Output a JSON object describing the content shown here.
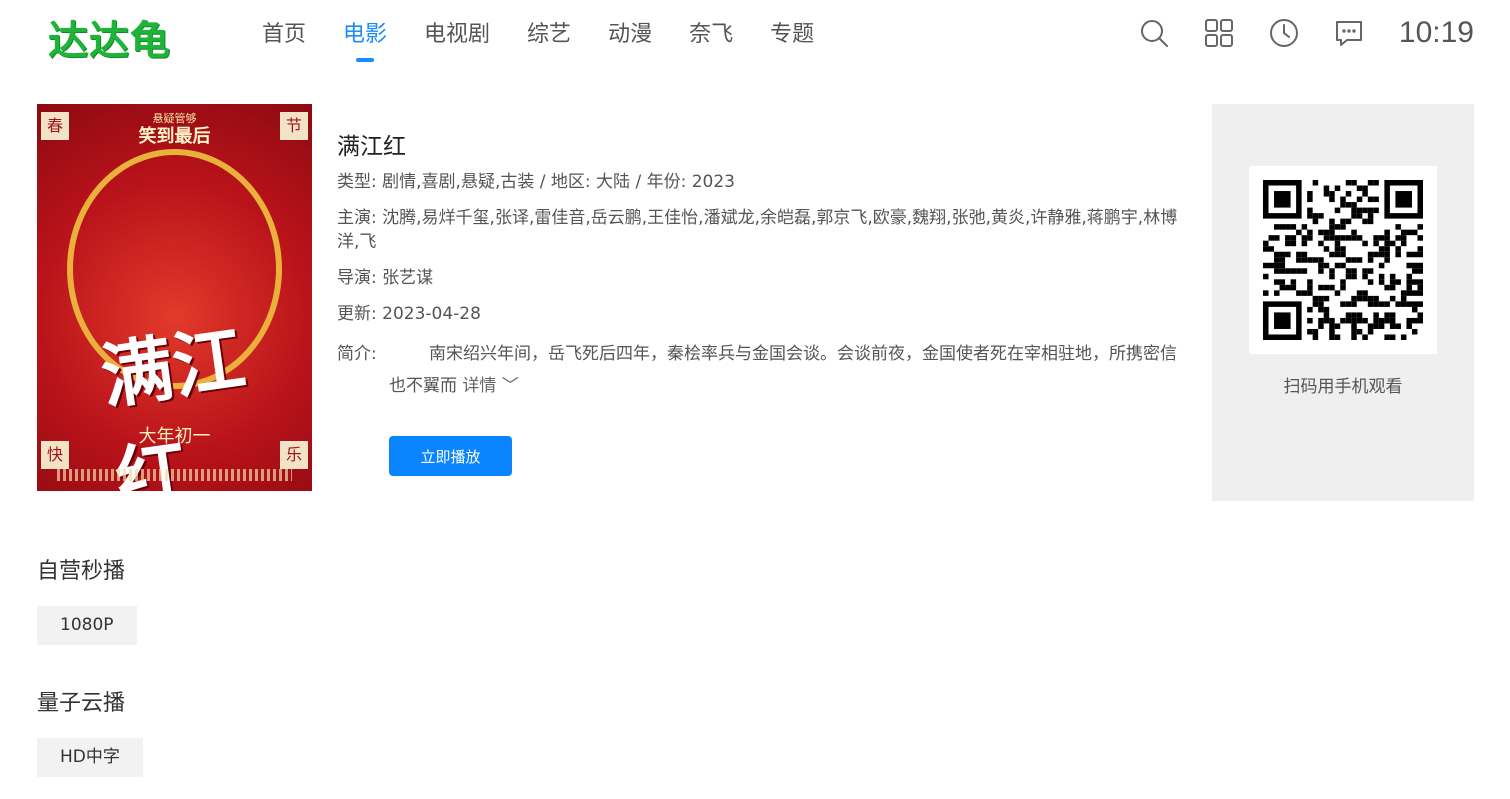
{
  "header": {
    "logo": "达达龟",
    "nav": [
      "首页",
      "电影",
      "电视剧",
      "综艺",
      "动漫",
      "奈飞",
      "专题"
    ],
    "active_nav": "电影",
    "time": "10:19",
    "icons": [
      "search-icon",
      "grid-icon",
      "history-icon",
      "message-icon"
    ]
  },
  "poster": {
    "corners": [
      "春",
      "节",
      "快",
      "乐"
    ],
    "tagline_small": "悬疑管够",
    "tagline": "笑到最后",
    "title_art": "满江红",
    "release": "大年初一"
  },
  "movie": {
    "title": "满江红",
    "type_label": "类型:",
    "type_value": "剧情,喜剧,悬疑,古装",
    "sep1": " / ",
    "region_label": "地区:",
    "region_value": "大陆",
    "sep2": " / ",
    "year_label": "年份:",
    "year_value": "2023",
    "cast_label": "主演:",
    "cast_value": "沈腾,易烊千玺,张译,雷佳音,岳云鹏,王佳怡,潘斌龙,余皑磊,郭京飞,欧豪,魏翔,张弛,黄炎,许静雅,蒋鹏宇,林博洋,飞",
    "director_label": "导演:",
    "director_value": "张艺谋",
    "updated_label": "更新:",
    "updated_value": "2023-04-28",
    "intro_label": "简介:",
    "intro_value": "南宋绍兴年间，岳飞死后四年，秦桧率兵与金国会谈。会谈前夜，金国使者死在宰相驻地，所携密信也不翼而",
    "more_label": "详情 ﹀",
    "play_label": "立即播放"
  },
  "qr": {
    "caption": "扫码用手机观看"
  },
  "sources": [
    {
      "title": "自营秒播",
      "episodes": [
        "1080P"
      ]
    },
    {
      "title": "量子云播",
      "episodes": [
        "HD中字"
      ]
    }
  ]
}
